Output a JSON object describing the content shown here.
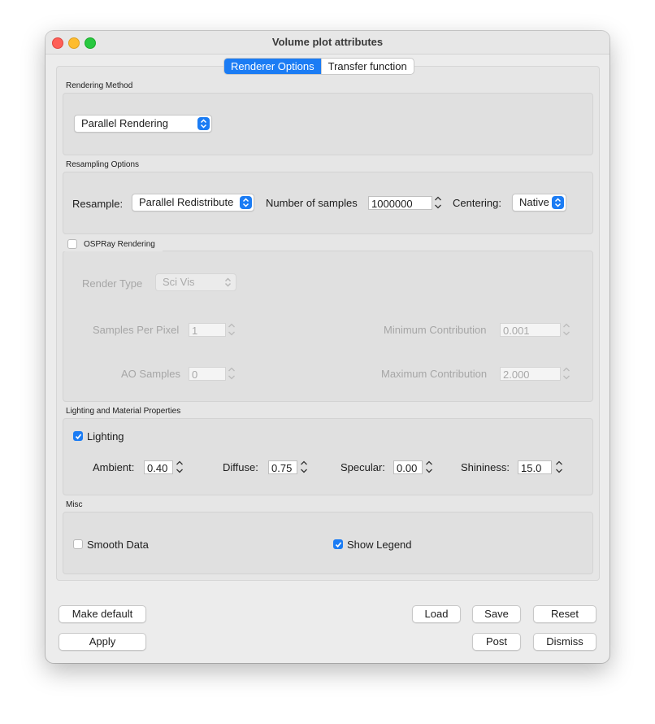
{
  "window": {
    "title": "Volume plot attributes"
  },
  "tabs": [
    {
      "label": "Renderer Options",
      "active": true
    },
    {
      "label": "Transfer function",
      "active": false
    }
  ],
  "rendering_method": {
    "title": "Rendering Method",
    "method": "Parallel Rendering"
  },
  "resampling": {
    "title": "Resampling Options",
    "resample_label": "Resample:",
    "resample_value": "Parallel Redistribute",
    "samples_label": "Number of samples",
    "samples_value": "1000000",
    "centering_label": "Centering:",
    "centering_value": "Native"
  },
  "ospray": {
    "title": "OSPRay Rendering",
    "enabled": false,
    "render_type_label": "Render Type",
    "render_type_value": "Sci Vis",
    "spp_label": "Samples Per Pixel",
    "spp_value": "1",
    "min_contrib_label": "Minimum Contribution",
    "min_contrib_value": "0.001",
    "ao_label": "AO Samples",
    "ao_value": "0",
    "max_contrib_label": "Maximum Contribution",
    "max_contrib_value": "2.000"
  },
  "lighting": {
    "title": "Lighting and Material Properties",
    "lighting_label": "Lighting",
    "lighting_checked": true,
    "ambient_label": "Ambient:",
    "ambient_value": "0.40",
    "diffuse_label": "Diffuse:",
    "diffuse_value": "0.75",
    "specular_label": "Specular:",
    "specular_value": "0.00",
    "shininess_label": "Shininess:",
    "shininess_value": "15.0"
  },
  "misc": {
    "title": "Misc",
    "smooth_label": "Smooth Data",
    "smooth_checked": false,
    "legend_label": "Show Legend",
    "legend_checked": true
  },
  "buttons": {
    "make_default": "Make default",
    "apply": "Apply",
    "load": "Load",
    "save": "Save",
    "reset": "Reset",
    "post": "Post",
    "dismiss": "Dismiss"
  },
  "colors": {
    "accent": "#1b7cf4",
    "window_bg": "#ececec",
    "group_bg": "#e0e0e0"
  }
}
